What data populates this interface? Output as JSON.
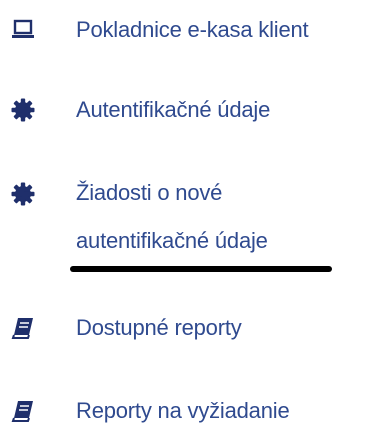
{
  "menu": {
    "items": [
      {
        "label": "Pokladnice e-kasa klient",
        "icon": "laptop-icon"
      },
      {
        "label": "Autentifikačné údaje",
        "icon": "gear-badge-icon"
      },
      {
        "label_line1": "Žiadosti o nové",
        "label_line2": "autentifikačné údaje",
        "icon": "gear-badge-icon",
        "highlighted": true
      },
      {
        "label": "Dostupné reporty",
        "icon": "book-icon"
      },
      {
        "label": "Reporty na vyžiadanie",
        "icon": "book-icon"
      }
    ]
  },
  "colors": {
    "link_text": "#2f4a8f",
    "icon": "#1f2f6b",
    "underline": "#000000"
  }
}
